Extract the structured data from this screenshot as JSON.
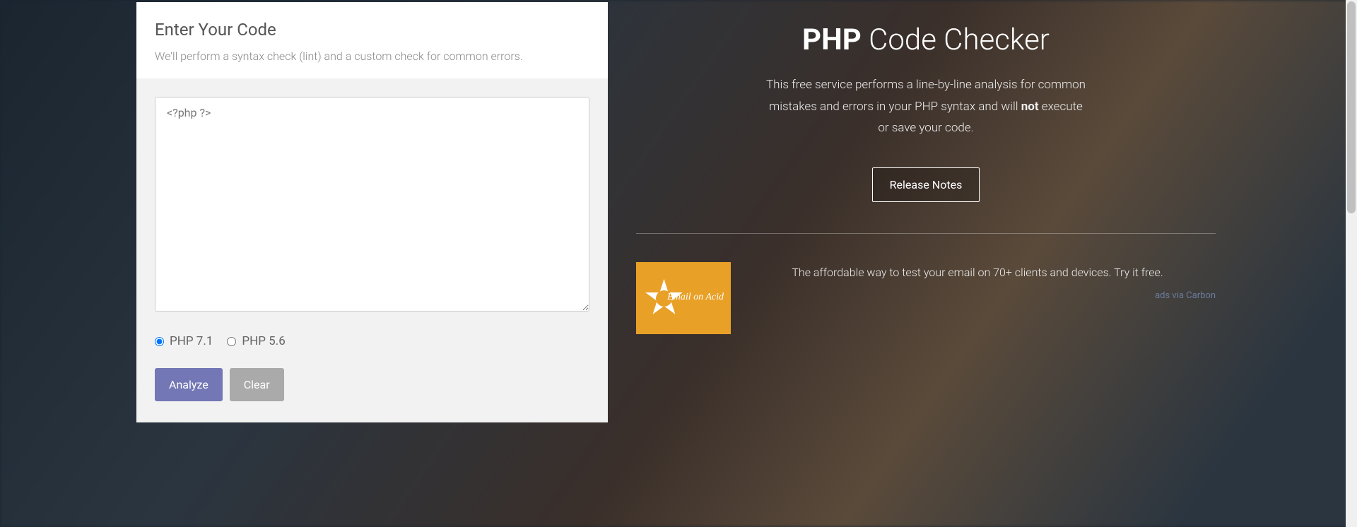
{
  "card": {
    "heading": "Enter Your Code",
    "subheading": "We'll perform a syntax check (lint) and a custom check for common errors.",
    "placeholder": "<?php ?>",
    "radios": [
      {
        "label": "PHP 7.1",
        "checked": true
      },
      {
        "label": "PHP 5.6",
        "checked": false
      }
    ],
    "analyze_label": "Analyze",
    "clear_label": "Clear"
  },
  "hero": {
    "title_bold": "PHP",
    "title_rest": " Code Checker",
    "desc_before": "This free service performs a line-by-line analysis for common mistakes and errors in your PHP syntax and will ",
    "desc_bold": "not",
    "desc_after": " execute or save your code.",
    "release_label": "Release Notes"
  },
  "ad": {
    "brand": "Email on Acid",
    "copy": "The affordable way to test your email on 70+ clients and devices. Try it free.",
    "credit": "ads via Carbon"
  }
}
